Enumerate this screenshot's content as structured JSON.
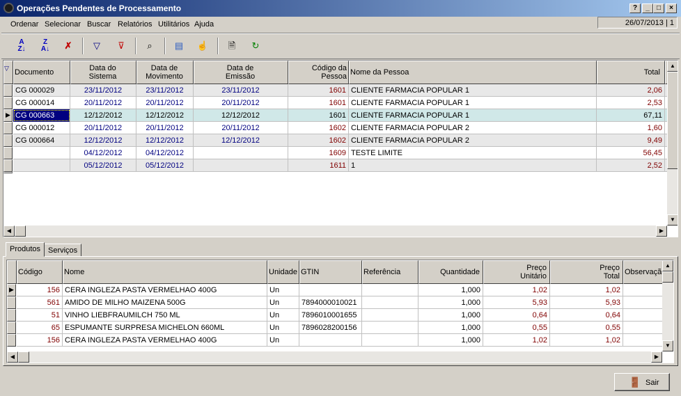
{
  "window": {
    "title": "Operações Pendentes de Processamento",
    "btn_help": "?",
    "btn_min": "_",
    "btn_max": "□",
    "btn_close": "×"
  },
  "menu": [
    "Ordenar",
    "Selecionar",
    "Buscar",
    "Relatórios",
    "Utilitários",
    "Ajuda"
  ],
  "status_date": "26/07/2013 | 1",
  "toolbar_icons": [
    "sort-ascending-icon",
    "sort-descending-icon",
    "clear-sort-icon",
    "filter-icon",
    "clear-filter-icon",
    "binoculars-icon",
    "columns-icon",
    "hand-select-icon",
    "preview-icon",
    "refresh-icon"
  ],
  "operations": {
    "columns": [
      "Documento",
      "Data do\nSistema",
      "Data de\nMovimento",
      "Data de\nEmissão",
      "Código da\nPessoa",
      "Nome da Pessoa",
      "Total"
    ],
    "rows": [
      [
        "CG 000029",
        "23/11/2012",
        "23/11/2012",
        "23/11/2012",
        "1601",
        "CLIENTE FARMACIA POPULAR 1",
        "2,06"
      ],
      [
        "CG 000014",
        "20/11/2012",
        "20/11/2012",
        "20/11/2012",
        "1601",
        "CLIENTE FARMACIA POPULAR 1",
        "2,53"
      ],
      [
        "CG 000663",
        "12/12/2012",
        "12/12/2012",
        "12/12/2012",
        "1601",
        "CLIENTE FARMACIA POPULAR 1",
        "67,11"
      ],
      [
        "CG 000012",
        "20/11/2012",
        "20/11/2012",
        "20/11/2012",
        "1602",
        "CLIENTE FARMACIA POPULAR 2",
        "1,60"
      ],
      [
        "CG 000664",
        "12/12/2012",
        "12/12/2012",
        "12/12/2012",
        "1602",
        "CLIENTE FARMACIA POPULAR 2",
        "9,49"
      ],
      [
        "",
        "04/12/2012",
        "04/12/2012",
        "",
        "1609",
        "TESTE LIMITE",
        "56,45"
      ],
      [
        "",
        "05/12/2012",
        "05/12/2012",
        "",
        "1611",
        "1",
        "2,52"
      ]
    ]
  },
  "tabs": [
    "Produtos",
    "Serviços"
  ],
  "products": {
    "columns": [
      "Código",
      "Nome",
      "Unidade",
      "GTIN",
      "Referência",
      "Quantidade",
      "Preço\nUnitário",
      "Preço\nTotal",
      "Observação"
    ],
    "rows": [
      [
        "156",
        "CERA INGLEZA PASTA VERMELHAO 400G",
        "Un",
        "",
        "",
        "1,000",
        "1,02",
        "1,02",
        ""
      ],
      [
        "561",
        "AMIDO DE MILHO MAIZENA 500G",
        "Un",
        "7894000010021",
        "",
        "1,000",
        "5,93",
        "5,93",
        ""
      ],
      [
        "51",
        "VINHO LIEBFRAUMILCH 750 ML",
        "Un",
        "7896010001655",
        "",
        "1,000",
        "0,64",
        "0,64",
        ""
      ],
      [
        "65",
        "ESPUMANTE SURPRESA MICHELON 660ML",
        "Un",
        "7896028200156",
        "",
        "1,000",
        "0,55",
        "0,55",
        ""
      ],
      [
        "156",
        "CERA INGLEZA PASTA VERMELHAO 400G",
        "Un",
        "",
        "",
        "1,000",
        "1,02",
        "1,02",
        ""
      ]
    ]
  },
  "exit_button": "Sair"
}
